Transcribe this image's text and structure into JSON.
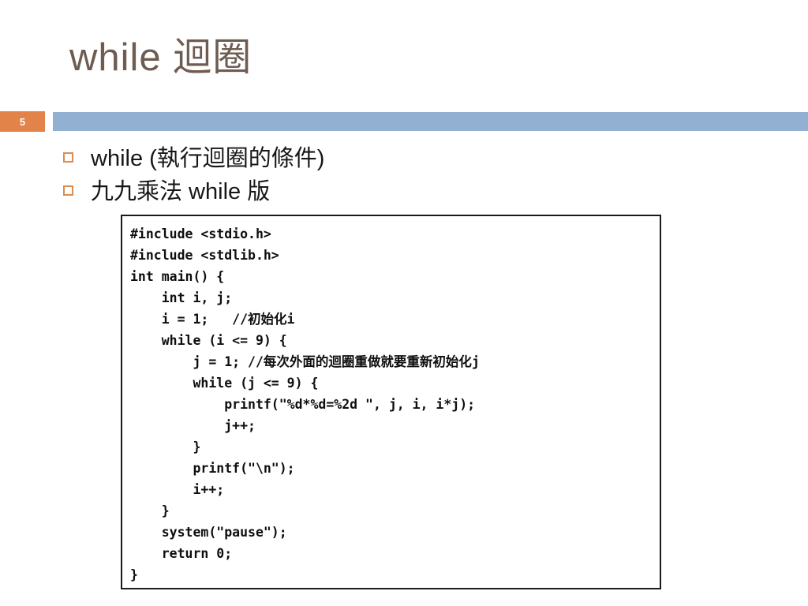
{
  "slide": {
    "title": "while 迴圈",
    "number": "5",
    "accent_orange": "#e2834a",
    "accent_blue": "#92b0d2",
    "title_color": "#6e5c51",
    "bullet_marker_color": "#dd8b4f"
  },
  "bullets": [
    {
      "marker": "hollow-square-bullet-icon",
      "text": "while (執行迴圈的條件)"
    },
    {
      "marker": "hollow-square-bullet-icon",
      "text": "九九乘法 while 版"
    }
  ],
  "code_block": {
    "language": "c",
    "lines": [
      "#include <stdio.h>",
      "#include <stdlib.h>",
      "int main() {",
      "    int i, j;",
      "    i = 1;   //初始化i",
      "    while (i <= 9) {",
      "        j = 1; //每次外面的迴圈重做就要重新初始化j",
      "        while (j <= 9) {",
      "            printf(\"%d*%d=%2d \", j, i, i*j);",
      "            j++;",
      "        }",
      "        printf(\"\\n\");",
      "        i++;",
      "    }",
      "    system(\"pause\");",
      "    return 0;",
      "}"
    ]
  }
}
